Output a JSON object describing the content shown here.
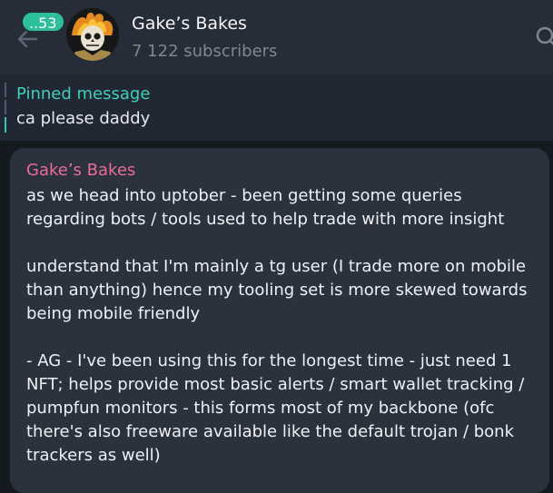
{
  "header": {
    "unread_badge": "..53",
    "channel_name": "Gake’s Bakes",
    "subscribers": "7 122 subscribers"
  },
  "pinned": {
    "label": "Pinned message",
    "text": "ca please daddy"
  },
  "message": {
    "author": "Gake’s Bakes",
    "paragraphs": [
      "as we head into uptober - been getting some queries regarding bots / tools used to help trade with more insight",
      "understand that I'm mainly a tg user (I trade more on mobile than anything) hence my tooling set is more skewed towards being mobile friendly",
      "- AG - I've been using this for the longest time - just need 1 NFT; helps provide most basic alerts / smart wallet tracking / pumpfun monitors - this forms most of my backbone (ofc there's also freeware available like the default trojan / bonk trackers as well)"
    ]
  },
  "colors": {
    "badge": "#2dbf9b",
    "pinned_label": "#3fd0b5",
    "author": "#ea6b9a"
  }
}
